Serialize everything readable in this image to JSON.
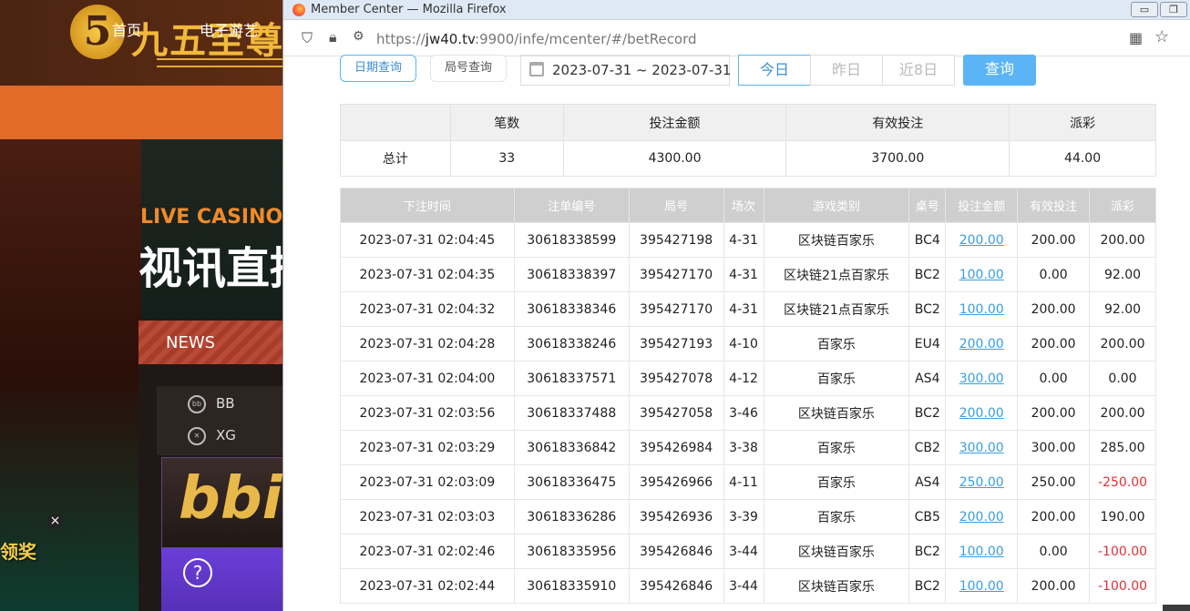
{
  "background": {
    "logo_glyph": "5",
    "logo_text": "九五至尊",
    "nav": [
      "首页",
      "电子游艺"
    ],
    "live_casino": "LIVE CASINO",
    "shixun": "视讯直播",
    "news": "NEWS",
    "providers": [
      "BB",
      "XG"
    ],
    "provider_icons": [
      "bb-icon",
      "xg-icon"
    ],
    "bbin_logo": "bbin",
    "help_glyph": "?",
    "promo_text": "领奖",
    "promo_close": "×"
  },
  "browser": {
    "title": "Member Center — Mozilla Firefox",
    "minimize": "▭",
    "restore": "❐",
    "url_prefix": "https://",
    "url_host": "jw40.tv",
    "url_rest": ":9900/infe/mcenter/#/betRecord"
  },
  "filters": {
    "date_query": "日期查询",
    "round_query": "局号查询",
    "date_range": "2023-07-31 ~ 2023-07-31",
    "today": "今日",
    "yesterday": "昨日",
    "last8": "近8日",
    "query": "查询"
  },
  "summary": {
    "headers": [
      "",
      "笔数",
      "投注金额",
      "有效投注",
      "派彩"
    ],
    "row": [
      "总计",
      "33",
      "4300.00",
      "3700.00",
      "44.00"
    ]
  },
  "records": {
    "headers": [
      "下注时间",
      "注单编号",
      "局号",
      "场次",
      "游戏类别",
      "桌号",
      "投注金额",
      "有效投注",
      "派彩"
    ],
    "rows": [
      [
        "2023-07-31 02:04:45",
        "30618338599",
        "395427198",
        "4-31",
        "区块链百家乐",
        "BC4",
        "200.00",
        "200.00",
        "200.00"
      ],
      [
        "2023-07-31 02:04:35",
        "30618338397",
        "395427170",
        "4-31",
        "区块链21点百家乐",
        "BC2",
        "100.00",
        "0.00",
        "92.00"
      ],
      [
        "2023-07-31 02:04:32",
        "30618338346",
        "395427170",
        "4-31",
        "区块链21点百家乐",
        "BC2",
        "100.00",
        "200.00",
        "92.00"
      ],
      [
        "2023-07-31 02:04:28",
        "30618338246",
        "395427193",
        "4-10",
        "百家乐",
        "EU4",
        "200.00",
        "200.00",
        "200.00"
      ],
      [
        "2023-07-31 02:04:00",
        "30618337571",
        "395427078",
        "4-12",
        "百家乐",
        "AS4",
        "300.00",
        "0.00",
        "0.00"
      ],
      [
        "2023-07-31 02:03:56",
        "30618337488",
        "395427058",
        "3-46",
        "区块链百家乐",
        "BC2",
        "200.00",
        "200.00",
        "200.00"
      ],
      [
        "2023-07-31 02:03:29",
        "30618336842",
        "395426984",
        "3-38",
        "百家乐",
        "CB2",
        "300.00",
        "300.00",
        "285.00"
      ],
      [
        "2023-07-31 02:03:09",
        "30618336475",
        "395426966",
        "4-11",
        "百家乐",
        "AS4",
        "250.00",
        "250.00",
        "-250.00"
      ],
      [
        "2023-07-31 02:03:03",
        "30618336286",
        "395426936",
        "3-39",
        "百家乐",
        "CB5",
        "200.00",
        "200.00",
        "190.00"
      ],
      [
        "2023-07-31 02:02:46",
        "30618335956",
        "395426846",
        "3-44",
        "区块链百家乐",
        "BC2",
        "100.00",
        "0.00",
        "-100.00"
      ],
      [
        "2023-07-31 02:02:44",
        "30618335910",
        "395426846",
        "3-44",
        "区块链百家乐",
        "BC2",
        "100.00",
        "200.00",
        "-100.00"
      ]
    ]
  },
  "colors": {
    "link": "#3a9ee0",
    "negative": "#e0303a",
    "query_button": "#5ab4f5"
  }
}
